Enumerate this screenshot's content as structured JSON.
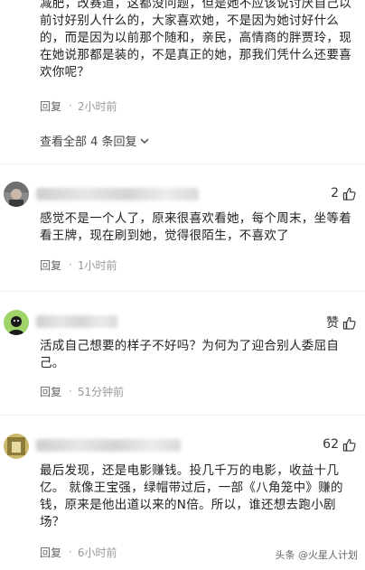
{
  "first_comment": {
    "text": "减肥，改赛道，这都没问题，但是她不应该说讨厌自己以前讨好别人什么的，大家喜欢她，不是因为她讨好什么的，而是因为以前那个随和，亲民，高情商的胖贾玲，现在她说那都是装的，不是真正的她，那我们凭什么还要喜欢你呢？",
    "reply_label": "回复",
    "dot": "·",
    "time": "2小时前"
  },
  "view_all_replies": "查看全部 4 条回复",
  "comments": [
    {
      "likes": "2",
      "text": "感觉不是一个人了，原来很喜欢看她，每个周末，坐等着看王牌，现在刷到她，觉得很陌生，不喜欢了",
      "reply_label": "回复",
      "dot": "·",
      "time": "1小时前"
    },
    {
      "likes": "赞",
      "text": "活成自己想要的样子不好吗？为何为了迎合别人委屈自己。",
      "reply_label": "回复",
      "dot": "·",
      "time": "51分钟前"
    },
    {
      "likes": "62",
      "text": "最后发现，还是电影赚钱。投几千万的电影，收益十几亿。 就像王宝强，绿帽带过后，一部《八角笼中》赚的钱，原来是他出道以来的N倍。所以，谁还想去跑小剧场？",
      "reply_label": "回复",
      "dot": "·",
      "time": "6小时前"
    }
  ],
  "watermark": "头条 @火星人计划",
  "colors": {
    "text": "#222222",
    "meta": "#999999",
    "separator": "#f0f0f0"
  }
}
